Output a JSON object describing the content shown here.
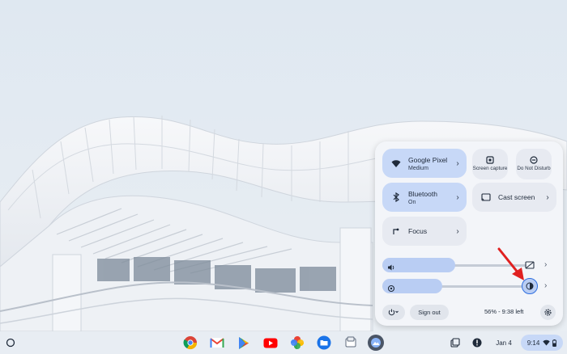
{
  "quick_settings": {
    "network": {
      "title": "Google Pixel",
      "subtitle": "Medium"
    },
    "screen_capture": {
      "label": "Screen capture"
    },
    "do_not_disturb": {
      "label": "Do Not Disturb"
    },
    "bluetooth": {
      "title": "Bluetooth",
      "subtitle": "On"
    },
    "cast": {
      "title": "Cast screen"
    },
    "focus": {
      "title": "Focus"
    },
    "volume": {
      "level_percent": 40
    },
    "brightness": {
      "level_percent": 33
    },
    "sign_out_label": "Sign out",
    "battery_text": "56% - 9:38 left"
  },
  "shelf": {
    "apps": [
      "Chrome",
      "Gmail",
      "Play Store",
      "YouTube",
      "Photos",
      "Files",
      "Tote",
      "Screenshot app"
    ],
    "date": "Jan 4",
    "time": "9:14"
  },
  "colors": {
    "tile_on": "#c7d8f7",
    "tile_off": "#e7eaf1",
    "panel_bg": "#f3f5f9",
    "annotation_arrow": "#e02020"
  }
}
